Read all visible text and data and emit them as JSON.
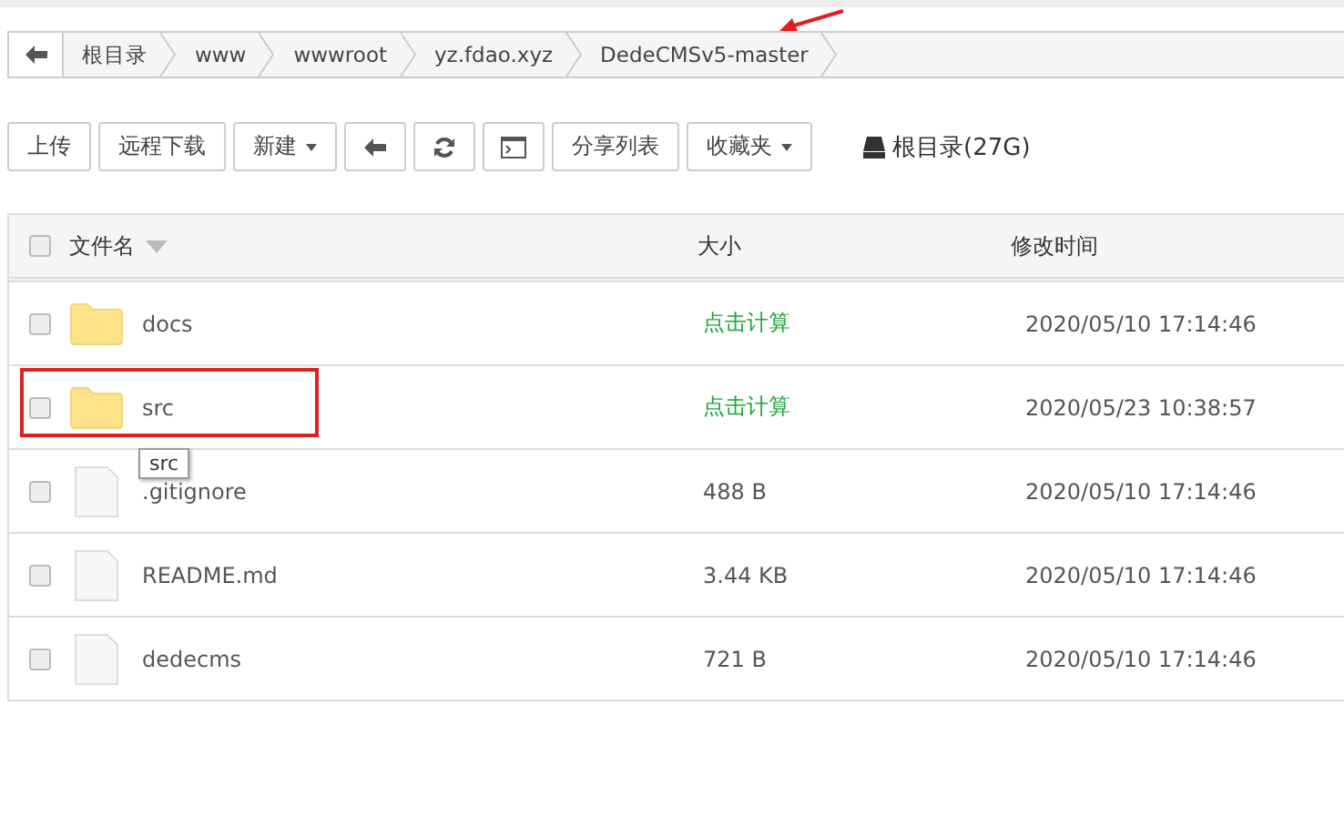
{
  "breadcrumb": {
    "items": [
      "根目录",
      "www",
      "wwwroot",
      "yz.fdao.xyz",
      "DedeCMSv5-master"
    ]
  },
  "toolbar": {
    "buttons": [
      {
        "kind": "text",
        "label": "上传",
        "dropdown": false
      },
      {
        "kind": "text",
        "label": "远程下载",
        "dropdown": false
      },
      {
        "kind": "text",
        "label": "新建",
        "dropdown": true
      },
      {
        "kind": "back"
      },
      {
        "kind": "refresh"
      },
      {
        "kind": "terminal"
      },
      {
        "kind": "text",
        "label": "分享列表",
        "dropdown": false
      },
      {
        "kind": "text",
        "label": "收藏夹",
        "dropdown": true
      }
    ],
    "disk": "根目录(27G)"
  },
  "table": {
    "select_all_checked": false,
    "columns": [
      {
        "label": "文件名",
        "sorted": true
      },
      {
        "label": "大小",
        "sorted": false
      },
      {
        "label": "修改时间",
        "sorted": false
      }
    ],
    "rows": [
      {
        "kind": "folder",
        "name": "docs",
        "size": {
          "text": "点击计算",
          "kind": "action"
        },
        "modified": "2020/05/10 17:14:46",
        "checked": false
      },
      {
        "kind": "folder",
        "name": "src",
        "size": {
          "text": "点击计算",
          "kind": "action"
        },
        "modified": "2020/05/23 10:38:57",
        "checked": false
      },
      {
        "kind": "file",
        "name": ".gitignore",
        "size": {
          "text": "488 B",
          "kind": "value"
        },
        "modified": "2020/05/10 17:14:46",
        "checked": false
      },
      {
        "kind": "file",
        "name": "README.md",
        "size": {
          "text": "3.44 KB",
          "kind": "value"
        },
        "modified": "2020/05/10 17:14:46",
        "checked": false
      },
      {
        "kind": "file",
        "name": "dedecms",
        "size": {
          "text": "721 B",
          "kind": "value"
        },
        "modified": "2020/05/10 17:14:46",
        "checked": false
      }
    ]
  },
  "tooltip": {
    "text": "src"
  }
}
